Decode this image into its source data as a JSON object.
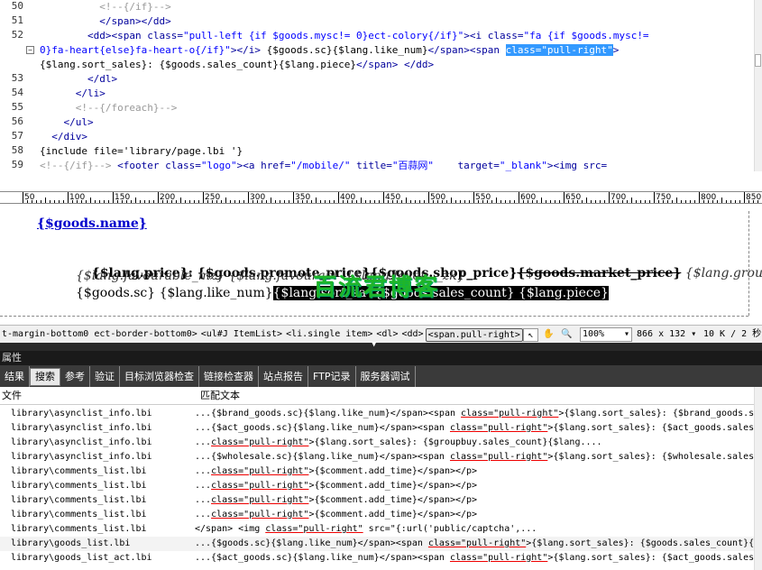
{
  "code": {
    "lines": [
      {
        "num": "50",
        "parts": [
          [
            "com",
            "          <!--{/if}-->"
          ]
        ]
      },
      {
        "num": "51",
        "parts": [
          [
            "tag",
            "          </span></dd>"
          ]
        ]
      },
      {
        "num": "52",
        "parts": [
          [
            "tag",
            "        <dd><span "
          ],
          [
            "att",
            "class="
          ],
          [
            "val",
            "\"pull-left {if $goods.mysc!= 0}ect-colory{/if}\""
          ],
          [
            "tag",
            "><i "
          ],
          [
            "att",
            "class="
          ],
          [
            "val",
            "\"fa {if $goods.mysc!="
          ]
        ]
      },
      {
        "num": "",
        "fold": "⊟",
        "parts": [
          [
            "val",
            "0}fa-heart{else}fa-heart-o{/if}\""
          ],
          [
            "tag",
            "></i>"
          ],
          [
            "txt",
            " {$goods.sc}{$lang.like_num}"
          ],
          [
            "tag",
            "</span><span "
          ],
          [
            "sel",
            "class=\"pull-right\""
          ],
          [
            "tag",
            ">"
          ]
        ]
      },
      {
        "num": "",
        "parts": [
          [
            "txt",
            "{$lang.sort_sales}: {$goods.sales_count}{$lang.piece}"
          ],
          [
            "tag",
            "</span> </dd>"
          ]
        ]
      },
      {
        "num": "53",
        "parts": [
          [
            "tag",
            "        </dl>"
          ]
        ]
      },
      {
        "num": "54",
        "parts": [
          [
            "tag",
            "      </li>"
          ]
        ]
      },
      {
        "num": "55",
        "parts": [
          [
            "com",
            "      <!--{/foreach}-->"
          ]
        ]
      },
      {
        "num": "56",
        "parts": [
          [
            "tag",
            "    </ul>"
          ]
        ]
      },
      {
        "num": "57",
        "parts": [
          [
            "tag",
            "  </div>"
          ]
        ]
      },
      {
        "num": "58",
        "parts": [
          [
            "txt",
            "{include file='library/page.lbi '}"
          ]
        ]
      },
      {
        "num": "59",
        "parts": [
          [
            "com",
            "<!--{/if}-->"
          ],
          [
            "tag",
            " <footer "
          ],
          [
            "att",
            "class="
          ],
          [
            "val",
            "\"logo\""
          ],
          [
            "tag",
            "><a "
          ],
          [
            "att",
            "href="
          ],
          [
            "val",
            "\"/mobile/\""
          ],
          [
            "att",
            " title="
          ],
          [
            "val",
            "\"百蒜网\""
          ],
          [
            "att",
            "    target="
          ],
          [
            "val",
            "\"_blank\""
          ],
          [
            "tag",
            "><img "
          ],
          [
            "att",
            "src="
          ]
        ]
      }
    ]
  },
  "ruler": {
    "ticks": [
      "50",
      "100",
      "150",
      "200",
      "250",
      "300",
      "350",
      "400",
      "450",
      "500",
      "550",
      "600",
      "650",
      "700",
      "750",
      "800",
      "850"
    ]
  },
  "design": {
    "goods_name": "{$goods.name}",
    "price_label": "{$lang.price}",
    "colon": ": ",
    "promote_price": "{$goods.promote_price}",
    "shop_price": "{$goods.shop_price}",
    "market_price": "{$goods.market_price}",
    "group_buy": " {$lang.group_buy_act}",
    "line3_a": "{$lang.favourable_mz} {$lang.favourabl",
    "line3_b": "  {$lang.favou",
    "line3_c": "  _zk}",
    "line4_a": "{$goods.sc} {$lang.like_num}",
    "line4_b": "{$lang.sort_sa",
    "line4_c": "  {$goods.sales_count}",
    "line4_d": " {$lang.piece}",
    "watermark": "百流君博客"
  },
  "status": {
    "crumbs": [
      "t-margin-bottom0 ect-border-bottom0>",
      "<ul#J ItemList>",
      "<li.single item>",
      "<dl>",
      "<dd>",
      "<span.pull-right>"
    ],
    "zoom": "100%",
    "size": "866 x 132",
    "filesize": "10 K / 2 秒"
  },
  "properties": {
    "title": "属性"
  },
  "tabs": [
    "结果",
    "搜索",
    "参考",
    "验证",
    "目标浏览器检查",
    "链接检查器",
    "站点报告",
    "FTP记录",
    "服务器调试"
  ],
  "results": {
    "col_file": "文件",
    "col_match": "匹配文本",
    "rows": [
      {
        "file": "library\\asynclist_info.lbi",
        "pre": "...{$brand_goods.sc}{$lang.like_num}</span><span ",
        "hit": "class=\"pull-right\"",
        "post": ">{$lang.sort_sales}: {$brand_goods.sa"
      },
      {
        "file": "library\\asynclist_info.lbi",
        "pre": "...{$act_goods.sc}{$lang.like_num}</span><span ",
        "hit": "class=\"pull-right\"",
        "post": ">{$lang.sort_sales}: {$act_goods.sales_"
      },
      {
        "file": "library\\asynclist_info.lbi",
        "pre": "...",
        "hit": "class=\"pull-right\"",
        "post": ">{$lang.sort_sales}: {$groupbuy.sales_count}{$lang...."
      },
      {
        "file": "library\\asynclist_info.lbi",
        "pre": "...{$wholesale.sc}{$lang.like_num}</span><span ",
        "hit": "class=\"pull-right\"",
        "post": ">{$lang.sort_sales}: {$wholesale.sales_"
      },
      {
        "file": "library\\comments_list.lbi",
        "pre": "...",
        "hit": "class=\"pull-right\"",
        "post": ">{$comment.add_time}</span></p>"
      },
      {
        "file": "library\\comments_list.lbi",
        "pre": "...",
        "hit": "class=\"pull-right\"",
        "post": ">{$comment.add_time}</span></p>"
      },
      {
        "file": "library\\comments_list.lbi",
        "pre": "...",
        "hit": "class=\"pull-right\"",
        "post": ">{$comment.add_time}</span></p>"
      },
      {
        "file": "library\\comments_list.lbi",
        "pre": "...",
        "hit": "class=\"pull-right\"",
        "post": ">{$comment.add_time}</span></p>"
      },
      {
        "file": "library\\comments_list.lbi",
        "pre": "   </span> <img ",
        "hit": "class=\"pull-right\"",
        "post": " src=\"{:url('public/captcha',..."
      },
      {
        "file": "library\\goods_list.lbi",
        "pre": "...{$goods.sc}{$lang.like_num}</span><span ",
        "hit": "class=\"pull-right\"",
        "post": ">{$lang.sort_sales}: {$goods.sales_count}{$"
      },
      {
        "file": "library\\goods_list_act.lbi",
        "pre": "...{$act_goods.sc}{$lang.like_num}</span><span ",
        "hit": "class=\"pull-right\"",
        "post": ">{$lang.sort_sales}: {$act_goods.sales_"
      }
    ]
  }
}
